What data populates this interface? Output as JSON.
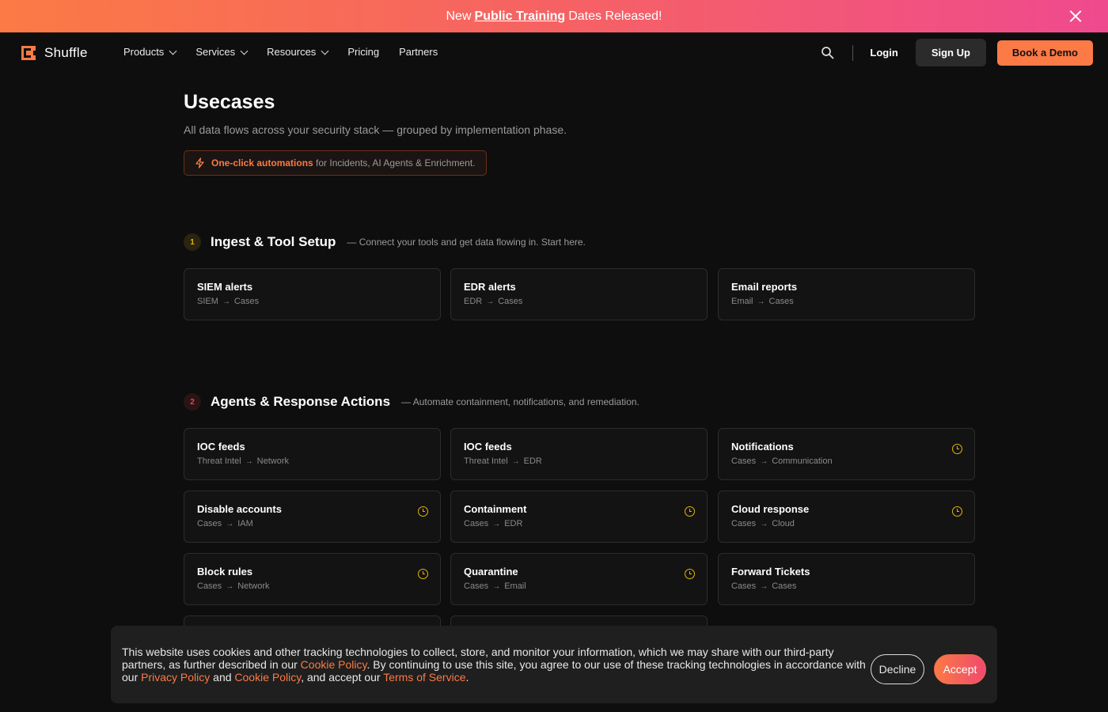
{
  "announcement": {
    "prefix": "New",
    "link": "Public Training",
    "suffix": "Dates Released!"
  },
  "nav": {
    "brand": "Shuffle",
    "items": [
      {
        "label": "Products",
        "dropdown": true
      },
      {
        "label": "Services",
        "dropdown": true
      },
      {
        "label": "Resources",
        "dropdown": true
      },
      {
        "label": "Pricing",
        "dropdown": false
      },
      {
        "label": "Partners",
        "dropdown": false
      }
    ],
    "login": "Login",
    "signup": "Sign Up",
    "demo": "Book a Demo"
  },
  "page": {
    "title": "Usecases",
    "subtitle": "All data flows across your security stack — grouped by implementation phase.",
    "promo_strong": "One-click automations",
    "promo_rest": "for Incidents, AI Agents & Enrichment."
  },
  "phases": [
    {
      "number": "1",
      "title": "Ingest & Tool Setup",
      "description": "— Connect your tools and get data flowing in. Start here.",
      "cards": [
        {
          "title": "SIEM alerts",
          "from": "SIEM",
          "to": "Cases",
          "pending": false
        },
        {
          "title": "EDR alerts",
          "from": "EDR",
          "to": "Cases",
          "pending": false
        },
        {
          "title": "Email reports",
          "from": "Email",
          "to": "Cases",
          "pending": false
        }
      ]
    },
    {
      "number": "2",
      "title": "Agents & Response Actions",
      "description": "— Automate containment, notifications, and remediation.",
      "cards": [
        {
          "title": "IOC feeds",
          "from": "Threat Intel",
          "to": "Network",
          "pending": false
        },
        {
          "title": "IOC feeds",
          "from": "Threat Intel",
          "to": "EDR",
          "pending": false
        },
        {
          "title": "Notifications",
          "from": "Cases",
          "to": "Communication",
          "pending": true
        },
        {
          "title": "Disable accounts",
          "from": "Cases",
          "to": "IAM",
          "pending": true
        },
        {
          "title": "Containment",
          "from": "Cases",
          "to": "EDR",
          "pending": true
        },
        {
          "title": "Cloud response",
          "from": "Cases",
          "to": "Cloud",
          "pending": true
        },
        {
          "title": "Block rules",
          "from": "Cases",
          "to": "Network",
          "pending": true
        },
        {
          "title": "Quarantine",
          "from": "Cases",
          "to": "Email",
          "pending": true
        },
        {
          "title": "Forward Tickets",
          "from": "Cases",
          "to": "Cases",
          "pending": false
        }
      ]
    }
  ],
  "cookie": {
    "text1": "This website uses cookies and other tracking technologies to collect, store, and monitor your information, which we may share with our third-party partners, as further described in our",
    "link1": "Cookie Policy",
    "text2": ". By continuing to use this site, you agree to our use of these tracking technologies in accordance with our",
    "link2": "Privacy Policy",
    "text3": "and",
    "link3": "Cookie Policy",
    "text4": ", and accept our",
    "link4": "Terms of Service",
    "text5": ".",
    "decline": "Decline",
    "accept": "Accept"
  },
  "colors": {
    "accent": "#fb7a45",
    "pending_icon": "#e6b400",
    "phase1_badge": "#e6b400",
    "phase2_badge": "#e5484d"
  }
}
